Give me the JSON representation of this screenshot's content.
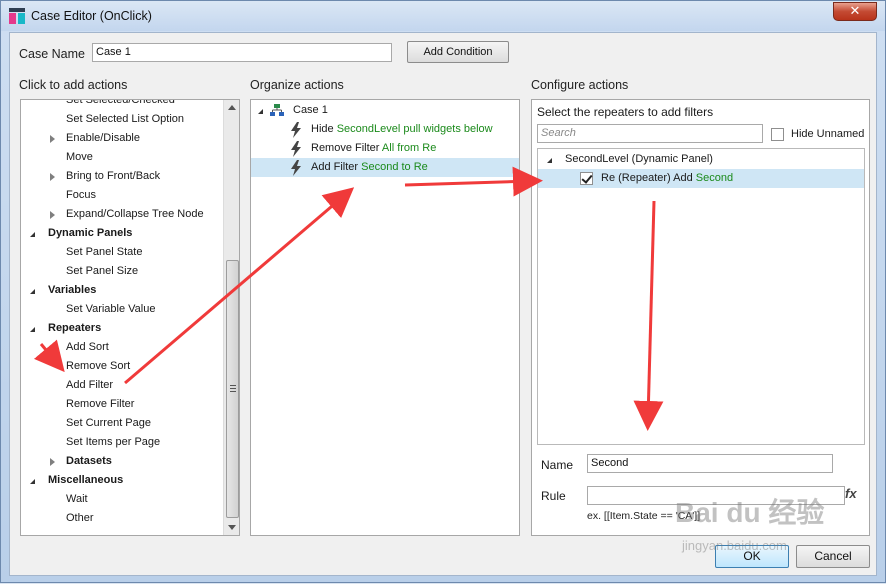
{
  "window": {
    "title": "Case Editor (OnClick)",
    "close_glyph": "✕"
  },
  "case_name": {
    "label": "Case Name",
    "value": "Case 1",
    "add_condition": "Add Condition"
  },
  "left": {
    "header": "Click to add actions",
    "items": [
      {
        "label": "Set Selected/Checked",
        "type": "item"
      },
      {
        "label": "Set Selected List Option",
        "type": "item"
      },
      {
        "label": "Enable/Disable",
        "type": "item",
        "expand": "closed"
      },
      {
        "label": "Move",
        "type": "item"
      },
      {
        "label": "Bring to Front/Back",
        "type": "item",
        "expand": "closed"
      },
      {
        "label": "Focus",
        "type": "item"
      },
      {
        "label": "Expand/Collapse Tree Node",
        "type": "item",
        "expand": "closed"
      },
      {
        "label": "Dynamic Panels",
        "type": "cat"
      },
      {
        "label": "Set Panel State",
        "type": "item"
      },
      {
        "label": "Set Panel Size",
        "type": "item"
      },
      {
        "label": "Variables",
        "type": "cat"
      },
      {
        "label": "Set Variable Value",
        "type": "item"
      },
      {
        "label": "Repeaters",
        "type": "cat"
      },
      {
        "label": "Add Sort",
        "type": "item"
      },
      {
        "label": "Remove Sort",
        "type": "item"
      },
      {
        "label": "Add Filter",
        "type": "item"
      },
      {
        "label": "Remove Filter",
        "type": "item"
      },
      {
        "label": "Set Current Page",
        "type": "item"
      },
      {
        "label": "Set Items per Page",
        "type": "item"
      },
      {
        "label": "Datasets",
        "type": "subcat"
      },
      {
        "label": "Miscellaneous",
        "type": "cat"
      },
      {
        "label": "Wait",
        "type": "item"
      },
      {
        "label": "Other",
        "type": "item"
      }
    ]
  },
  "middle": {
    "header": "Organize actions",
    "case_label": "Case 1",
    "actions": [
      {
        "prefix": "Hide ",
        "highlight": "SecondLevel pull widgets below",
        "suffix": ""
      },
      {
        "prefix": "Remove Filter ",
        "highlight": "All from Re",
        "suffix": ""
      },
      {
        "prefix": "Add Filter ",
        "highlight": "Second to Re",
        "suffix": ""
      }
    ]
  },
  "right": {
    "header": "Configure actions",
    "select_label": "Select the repeaters to add filters",
    "search_placeholder": "Search",
    "hide_unnamed": "Hide Unnamed",
    "tree_parent": "SecondLevel (Dynamic Panel)",
    "tree_child_prefix": "Re (Repeater) Add ",
    "tree_child_highlight": "Second",
    "name_label": "Name",
    "name_value": "Second",
    "rule_label": "Rule",
    "rule_value": "",
    "fx": "fx",
    "example": "ex. [[Item.State == 'CA']]"
  },
  "footer": {
    "ok": "OK",
    "cancel": "Cancel"
  },
  "watermark": {
    "brand": "Bai du 经验",
    "url": "jingyan.baidu.com"
  },
  "colors": {
    "highlight_text": "#1b8a1b",
    "selected_row": "#cfe6f5",
    "annotation_arrow": "#f03a3a"
  }
}
